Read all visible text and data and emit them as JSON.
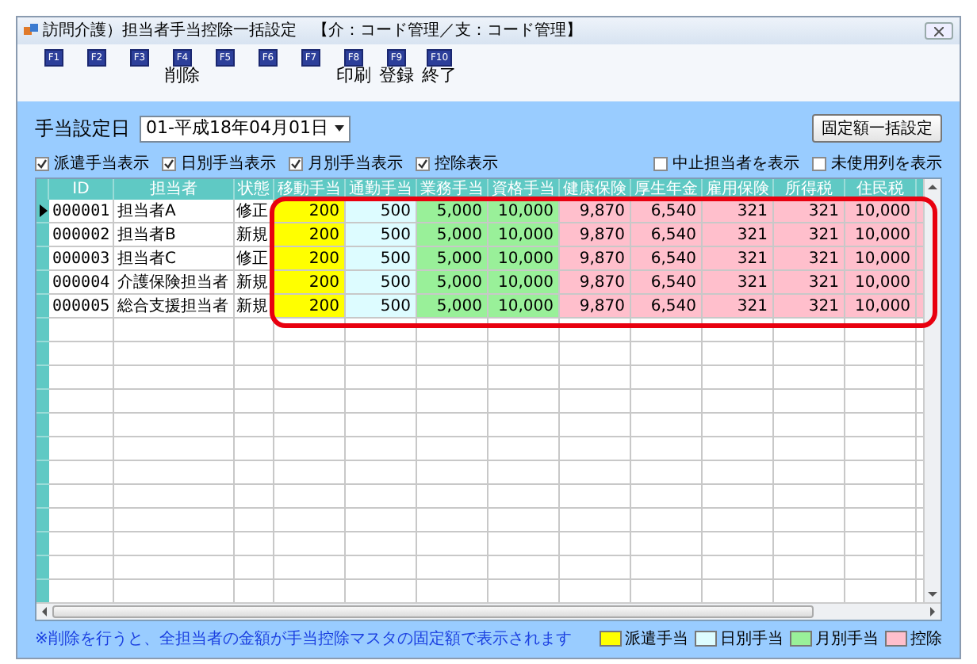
{
  "window": {
    "title": "訪問介護）担当者手当控除一括設定　【介：コード管理／支：コード管理】"
  },
  "function_keys": [
    {
      "key": "F1"
    },
    {
      "key": "F2"
    },
    {
      "key": "F3"
    },
    {
      "key": "F4",
      "label": "削除"
    },
    {
      "key": "F5"
    },
    {
      "key": "F6"
    },
    {
      "key": "F7"
    },
    {
      "key": "F8",
      "label": "印刷"
    },
    {
      "key": "F9",
      "label": "登録"
    },
    {
      "key": "F10",
      "label": "終了"
    }
  ],
  "date_setting": {
    "label": "手当設定日",
    "value": "01-平成18年04月01日"
  },
  "fixed_button": "固定額一括設定",
  "left_checks": [
    {
      "label": "派遣手当表示",
      "checked": true
    },
    {
      "label": "日別手当表示",
      "checked": true
    },
    {
      "label": "月別手当表示",
      "checked": true
    },
    {
      "label": "控除表示",
      "checked": true
    }
  ],
  "right_checks": [
    {
      "label": "中止担当者を表示",
      "checked": false
    },
    {
      "label": "未使用列を表示",
      "checked": false
    }
  ],
  "table": {
    "columns": [
      "ID",
      "担当者",
      "状態"
    ],
    "value_columns": [
      {
        "label": "移動手当",
        "color": "#ffff00"
      },
      {
        "label": "通勤手当",
        "color": "#ddfcff"
      },
      {
        "label": "業務手当",
        "color": "#99f099"
      },
      {
        "label": "資格手当",
        "color": "#99f099"
      },
      {
        "label": "健康保険",
        "color": "#ffbfcc"
      },
      {
        "label": "厚生年金",
        "color": "#ffbfcc"
      },
      {
        "label": "雇用保険",
        "color": "#ffbfcc"
      },
      {
        "label": "所得税",
        "color": "#ffbfcc"
      },
      {
        "label": "住民税",
        "color": "#ffbfcc"
      }
    ],
    "rows": [
      {
        "selected": true,
        "id": "000001",
        "name": "担当者A",
        "status": "修正",
        "values": [
          "200",
          "500",
          "5,000",
          "10,000",
          "9,870",
          "6,540",
          "321",
          "321",
          "10,000"
        ]
      },
      {
        "selected": false,
        "id": "000002",
        "name": "担当者B",
        "status": "新規",
        "values": [
          "200",
          "500",
          "5,000",
          "10,000",
          "9,870",
          "6,540",
          "321",
          "321",
          "10,000"
        ]
      },
      {
        "selected": false,
        "id": "000003",
        "name": "担当者C",
        "status": "修正",
        "values": [
          "200",
          "500",
          "5,000",
          "10,000",
          "9,870",
          "6,540",
          "321",
          "321",
          "10,000"
        ]
      },
      {
        "selected": false,
        "id": "000004",
        "name": "介護保険担当者",
        "status": "新規",
        "values": [
          "200",
          "500",
          "5,000",
          "10,000",
          "9,870",
          "6,540",
          "321",
          "321",
          "10,000"
        ]
      },
      {
        "selected": false,
        "id": "000005",
        "name": "総合支援担当者",
        "status": "新規",
        "values": [
          "200",
          "500",
          "5,000",
          "10,000",
          "9,870",
          "6,540",
          "321",
          "321",
          "10,000"
        ]
      }
    ]
  },
  "note": "※削除を行うと、全担当者の金額が手当控除マスタの固定額で表示されます",
  "legend": [
    {
      "label": "派遣手当",
      "color": "#ffff00"
    },
    {
      "label": "日別手当",
      "color": "#ddfcff"
    },
    {
      "label": "月別手当",
      "color": "#99f099"
    },
    {
      "label": "控除",
      "color": "#ffbfcc"
    }
  ]
}
